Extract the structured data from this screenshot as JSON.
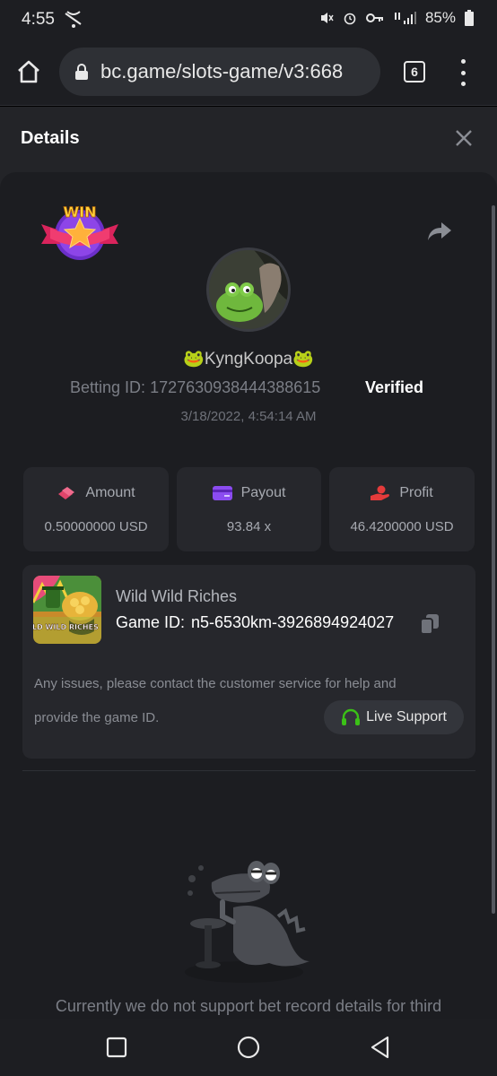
{
  "status_bar": {
    "time": "4:55",
    "battery": "85%"
  },
  "browser": {
    "url": "bc.game/slots-game/v3:668",
    "tab_count": "6"
  },
  "header": {
    "title": "Details"
  },
  "bet": {
    "badge_text": "WIN",
    "username": "🐸KyngKoopa🐸",
    "betting_id_label": "Betting ID:",
    "betting_id": "1727630938444388615",
    "verified": "Verified",
    "timestamp": "3/18/2022, 4:54:14 AM"
  },
  "stats": [
    {
      "label": "Amount",
      "value": "0.50000000 USD",
      "icon": "amount-icon",
      "color": "#e0446a"
    },
    {
      "label": "Payout",
      "value": "93.84 x",
      "icon": "payout-card-icon",
      "color": "#8b4cf0"
    },
    {
      "label": "Profit",
      "value": "46.4200000 USD",
      "icon": "profit-hand-icon",
      "color": "#e53b3b"
    }
  ],
  "game": {
    "name": "Wild Wild Riches",
    "thumb_text": "WILD WILD RICHES",
    "id_label": "Game ID:",
    "id_value": "n5-6530km-3926894924027",
    "issues_line1": "Any issues, please contact the customer service for help and",
    "issues_line2": "provide the game ID.",
    "support_label": "Live Support"
  },
  "footer_note": "Currently we do not support bet record details for third",
  "colors": {
    "support_icon": "#3bc117",
    "page_bg": "#232428",
    "card_bg": "#1c1d21",
    "tile_bg": "#26272c"
  }
}
